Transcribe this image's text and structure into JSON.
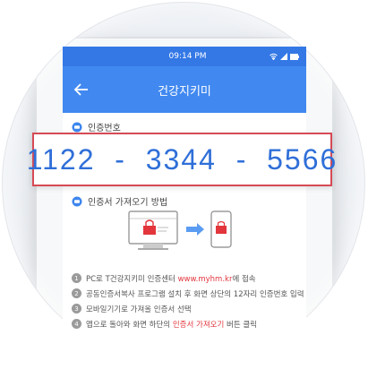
{
  "status_bar": {
    "time": "09:14 PM"
  },
  "app_bar": {
    "title": "건강지키미"
  },
  "sections": {
    "auth_code_title": "인증번호",
    "method_title": "인증서 가져오기 방법"
  },
  "auth_code": "1122  -  3344  -  5566",
  "steps": [
    {
      "num": "1",
      "text_a": "PC로 T건강지키미 인증센터 ",
      "highlight": "www.myhm.kr",
      "text_b": "에 접속"
    },
    {
      "num": "2",
      "text_a": "공동인증서복사 프로그램 설치 후 화면 상단의 12자리 인증번호 입력",
      "highlight": "",
      "text_b": ""
    },
    {
      "num": "3",
      "text_a": "모바일기기로 가져올 인증서 선택",
      "highlight": "",
      "text_b": ""
    },
    {
      "num": "4",
      "text_a": "앱으로 돌아와 화면 하단의 ",
      "highlight": "인증서 가져오기",
      "text_b": " 버튼 클릭"
    }
  ],
  "colors": {
    "accent": "#4189f0",
    "status_bar": "#3478e6",
    "code_border": "#d64a55",
    "code_text": "#2f6fd8",
    "highlight": "#e2363c"
  },
  "icons": [
    "back-arrow-icon",
    "chat-bubble-icon",
    "monitor-icon",
    "lock-icon",
    "arrow-right-icon",
    "smartphone-icon",
    "wifi-icon",
    "signal-icon",
    "battery-icon"
  ]
}
